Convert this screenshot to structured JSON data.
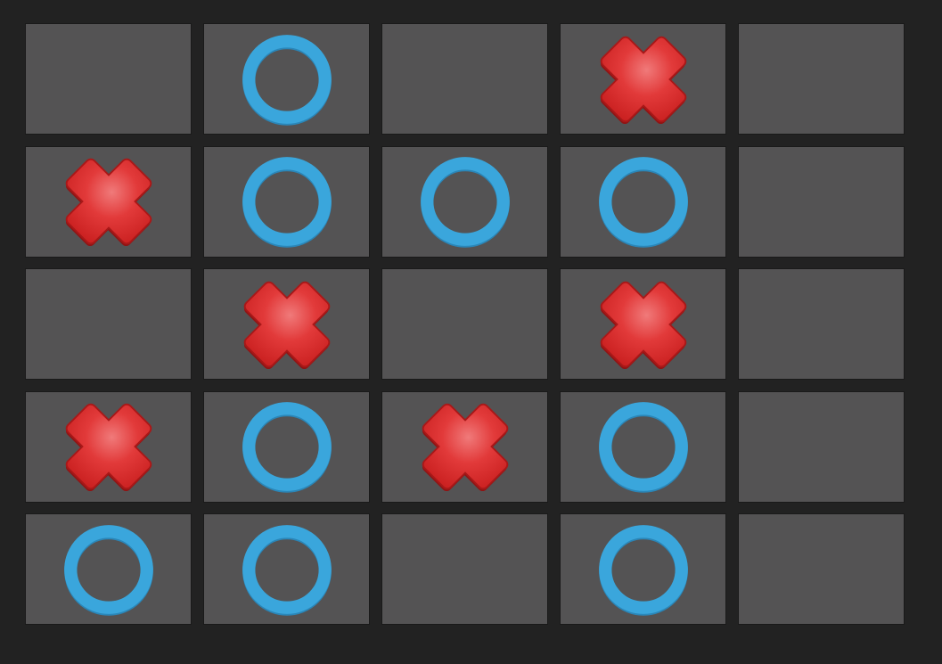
{
  "game": {
    "type": "tic-tac-toe",
    "rows": 5,
    "cols": 5,
    "board": [
      [
        "",
        "O",
        "",
        "X",
        ""
      ],
      [
        "X",
        "O",
        "O",
        "O",
        ""
      ],
      [
        "",
        "X",
        "",
        "X",
        ""
      ],
      [
        "X",
        "O",
        "X",
        "O",
        ""
      ],
      [
        "O",
        "O",
        "",
        "O",
        ""
      ]
    ]
  },
  "colors": {
    "background": "#222222",
    "cell": "#545354",
    "x_mark": "#d42a2a",
    "o_mark": "#3aa6dc"
  },
  "icons": {
    "X": "x-mark-icon",
    "O": "o-mark-icon"
  }
}
